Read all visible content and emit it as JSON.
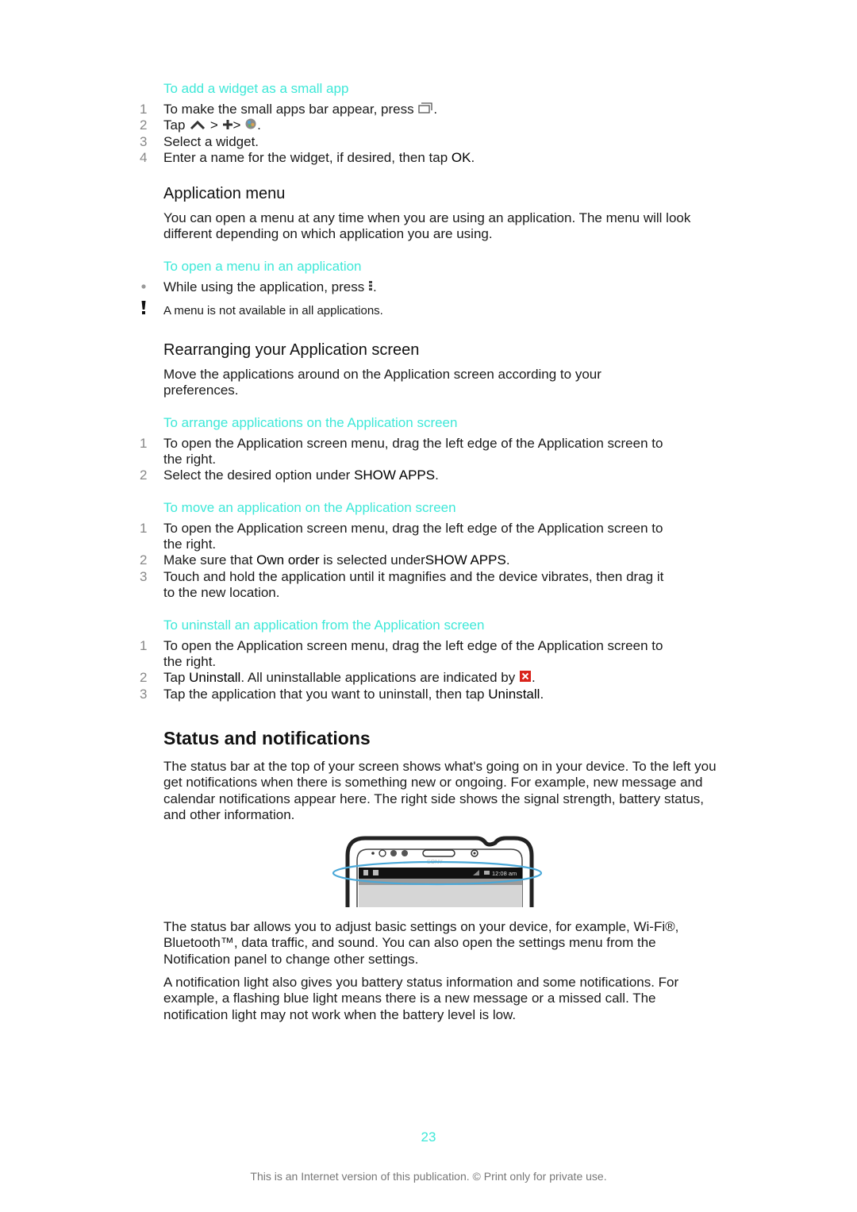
{
  "colors": {
    "accent": "#3ee8d8",
    "text": "#1a1a1a",
    "muted": "#888888",
    "uninstall_icon": "#d9241c",
    "highlight_ring": "#4aa8d8"
  },
  "widget_section": {
    "title": "To add a widget as a small app",
    "steps": [
      {
        "num": "1",
        "pre": "To make the small apps bar appear, press ",
        "icon": "recent-apps-icon",
        "post": "."
      },
      {
        "num": "2",
        "pre": "Tap ",
        "icon1": "chevron-up-icon",
        "sep1": " > ",
        "icon2": "plus-icon",
        "sep2": "> ",
        "icon3": "widget-globe-icon",
        "post": "."
      },
      {
        "num": "3",
        "text": "Select a widget."
      },
      {
        "num": "4",
        "pre": "Enter a name for the widget, if desired, then tap ",
        "bold": "OK",
        "post": "."
      }
    ]
  },
  "app_menu": {
    "heading": "Application menu",
    "body": "You can open a menu at any time when you are using an application. The menu will look different depending on which application you are using.",
    "proc_title": "To open a menu in an application",
    "bullet": {
      "pre": "While using the application, press ",
      "icon": "menu-dots-icon",
      "post": "."
    },
    "note": "A menu is not available in all applications."
  },
  "rearrange": {
    "heading": "Rearranging your Application screen",
    "body": "Move the applications around on the Application screen according to your preferences.",
    "arrange": {
      "title": "To arrange applications on the Application screen",
      "steps": [
        {
          "num": "1",
          "text": "To open the Application screen menu, drag the left edge of the Application screen to the right."
        },
        {
          "num": "2",
          "pre": "Select the desired option under ",
          "bold": "SHOW APPS",
          "post": "."
        }
      ]
    },
    "move": {
      "title": "To move an application on the Application screen",
      "steps": [
        {
          "num": "1",
          "text": "To open the Application screen menu, drag the left edge of the Application screen to the right."
        },
        {
          "num": "2",
          "pre": "Make sure that ",
          "bold1": "Own order",
          "mid": " is selected under",
          "bold2": "SHOW APPS",
          "post": "."
        },
        {
          "num": "3",
          "text": "Touch and hold the application until it magnifies and the device vibrates, then drag it to the new location."
        }
      ]
    },
    "uninstall": {
      "title": "To uninstall an application from the Application screen",
      "steps": [
        {
          "num": "1",
          "text": "To open the Application screen menu, drag the left edge of the Application screen to the right."
        },
        {
          "num": "2",
          "pre": "Tap ",
          "bold": "Uninstall",
          "mid": ". All uninstallable applications are indicated by ",
          "icon": "uninstall-x-icon",
          "post": "."
        },
        {
          "num": "3",
          "pre": "Tap the application that you want to uninstall, then tap ",
          "bold": "Uninstall",
          "post": "."
        }
      ]
    }
  },
  "status": {
    "heading": "Status and notifications",
    "body1": "The status bar at the top of your screen shows what's going on in your device. To the left you get notifications when there is something new or ongoing. For example, new message and calendar notifications appear here. The right side shows the signal strength, battery status, and other information.",
    "illustration": {
      "clock": "12:08 am",
      "brand": "SONY"
    },
    "body2": "The status bar allows you to adjust basic settings on your device, for example, Wi-Fi®, Bluetooth™, data traffic, and sound. You can also open the settings menu from the Notification panel to change other settings.",
    "body3": "A notification light also gives you battery status information and some notifications. For example, a flashing blue light means there is a new message or a missed call. The notification light may not work when the battery level is low."
  },
  "footer": {
    "page_number": "23",
    "notice": "This is an Internet version of this publication. © Print only for private use."
  }
}
